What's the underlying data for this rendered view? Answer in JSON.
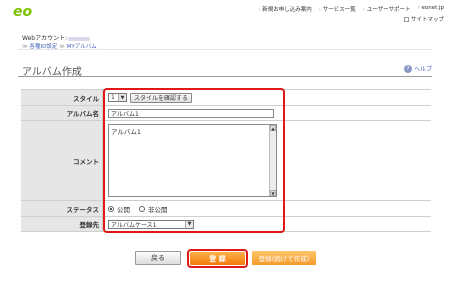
{
  "logo": {
    "text": "eo",
    "color": "#7cc000"
  },
  "topnav": {
    "items": [
      "新規お申し込み案内",
      "サービス一覧",
      "ユーザーサポート",
      "eonet.jp"
    ],
    "sitemap": "サイトマップ"
  },
  "account": {
    "label": "Webアカウント:"
  },
  "breadcrumb": {
    "item1": "各種ID設定",
    "item2": "MYアルバム"
  },
  "page": {
    "title": "アルバム作成",
    "help": "ヘルプ"
  },
  "form": {
    "style": {
      "label": "スタイル",
      "select_value": "1",
      "confirm_button": "スタイルを確認する"
    },
    "album_name": {
      "label": "アルバム名",
      "value": "アルバム1"
    },
    "comment": {
      "label": "コメント",
      "value": "アルバム1"
    },
    "status": {
      "label": "ステータス",
      "options": [
        "公開",
        "非公開"
      ],
      "selected": "公開"
    },
    "destination": {
      "label": "登録先",
      "select_value": "アルバムケース1"
    }
  },
  "buttons": {
    "back": "戻る",
    "register": "登 録",
    "register_continue": "登録(続けて作成)"
  },
  "colors": {
    "highlight": "#e01818",
    "accent_orange": "#f07a0c",
    "link_blue": "#4a68c0"
  }
}
